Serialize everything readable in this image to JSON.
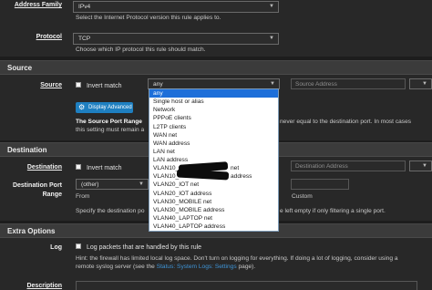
{
  "address_family": {
    "label": "Address Family",
    "value": "IPv4",
    "help": "Select the Internet Protocol version this rule applies to."
  },
  "protocol": {
    "label": "Protocol",
    "value": "TCP",
    "help": "Choose which IP protocol this rule should match."
  },
  "source": {
    "section_title": "Source",
    "label": "Source",
    "invert_label": "Invert match",
    "selected": "any",
    "address_placeholder": "Source Address",
    "display_advanced_label": "Display Advanced",
    "port_range_bold": "The Source Port Range",
    "port_help_left": "this setting must remain a",
    "port_help_right": "never equal to the destination port. In most cases"
  },
  "dropdown": {
    "options": [
      "any",
      "Single host or alias",
      "Network",
      "PPPoE clients",
      "L2TP clients",
      "WAN net",
      "WAN address",
      "LAN net",
      "LAN address",
      "VLAN10_",
      "VLAN10_",
      "VLAN20_IOT net",
      "VLAN20_IOT address",
      "VLAN30_MOBILE net",
      "VLAN30_MOBILE address",
      "VLAN40_LAPTOP net",
      "VLAN40_LAPTOP address"
    ],
    "trailing_left": [
      "",
      "",
      "",
      "",
      "",
      "",
      "",
      "",
      "",
      "net",
      "address",
      "",
      "",
      "",
      "",
      "",
      ""
    ],
    "selected_index": 0
  },
  "destination": {
    "section_title": "Destination",
    "label": "Destination",
    "invert_label": "Invert match",
    "address_placeholder": "Destination Address",
    "port_range_label_line1": "Destination Port",
    "port_range_label_line2": "Range",
    "from_value": "(other)",
    "from_label": "From",
    "custom_label": "Custom",
    "help_left": "Specify the destination po",
    "help_right": "e left empty if only filtering a single port."
  },
  "extra": {
    "section_title": "Extra Options",
    "log_label": "Log",
    "log_checkbox_label": "Log packets that are handled by this rule",
    "hint_line1": "Hint: the firewall has limited local log space. Don't turn on logging for everything. If doing a lot of logging, consider using a",
    "hint_line2_pre": "remote syslog server (see the ",
    "hint_link": "Status: System Logs: Settings",
    "hint_line2_post": " page).",
    "description_label": "Description"
  }
}
